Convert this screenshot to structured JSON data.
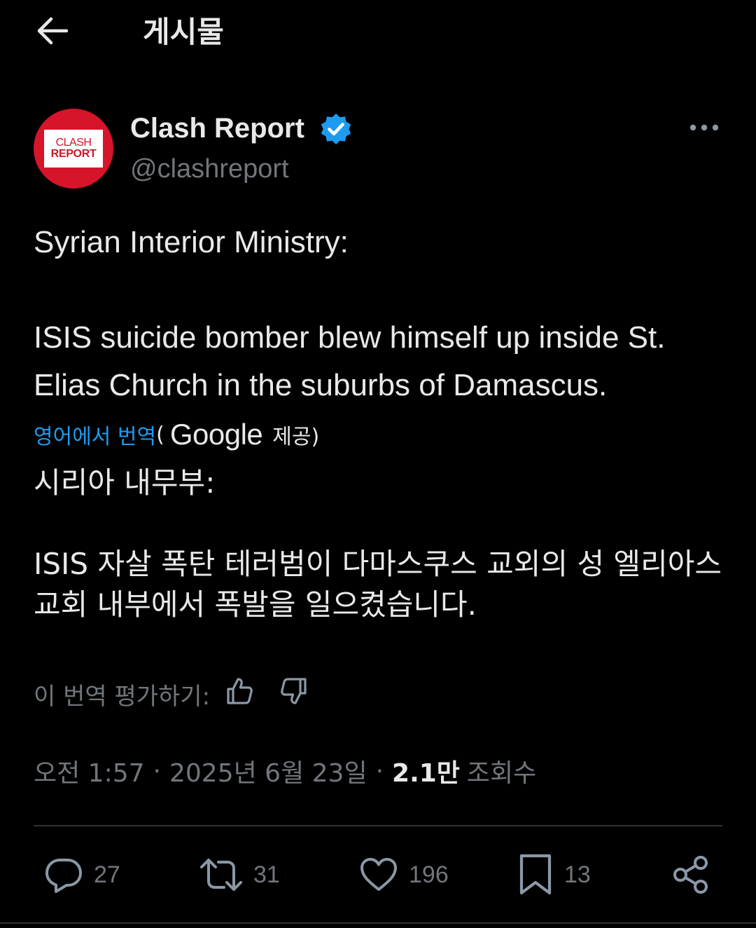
{
  "header": {
    "title": "게시물"
  },
  "author": {
    "name": "Clash Report",
    "handle": "@clashreport",
    "logo_line1": "CLASH",
    "logo_line2": "REPORT",
    "avatar_color": "#d6142a",
    "verified_color": "#1d9bf0"
  },
  "post": {
    "text": "Syrian Interior Ministry:\n\nISIS suicide bomber blew himself up inside St. Elias Church in the suburbs of Damascus."
  },
  "translation": {
    "link_label": "영어에서 번역",
    "paren_open": "(",
    "provider": "Google",
    "provided_label": "제공)",
    "text": "시리아 내무부:\n\nISIS 자살 폭탄 테러범이 다마스쿠스 교외의 성 엘리아스 교회 내부에서 폭발을 일으켰습니다.",
    "rate_label": "이 번역 평가하기:"
  },
  "meta": {
    "time": "오전 1:57",
    "separator": "·",
    "date": "2025년 6월 23일",
    "views_count": "2.1만",
    "views_label": "조회수"
  },
  "actions": {
    "replies": "27",
    "reposts": "31",
    "likes": "196",
    "bookmarks": "13"
  },
  "icons": {
    "back": "arrow-left-icon",
    "more": "more-dots-icon",
    "verified": "verified-badge-icon",
    "thumbs_up": "thumbs-up-icon",
    "thumbs_down": "thumbs-down-icon",
    "reply": "reply-icon",
    "repost": "repost-icon",
    "like": "heart-icon",
    "bookmark": "bookmark-icon",
    "share": "share-icon"
  }
}
